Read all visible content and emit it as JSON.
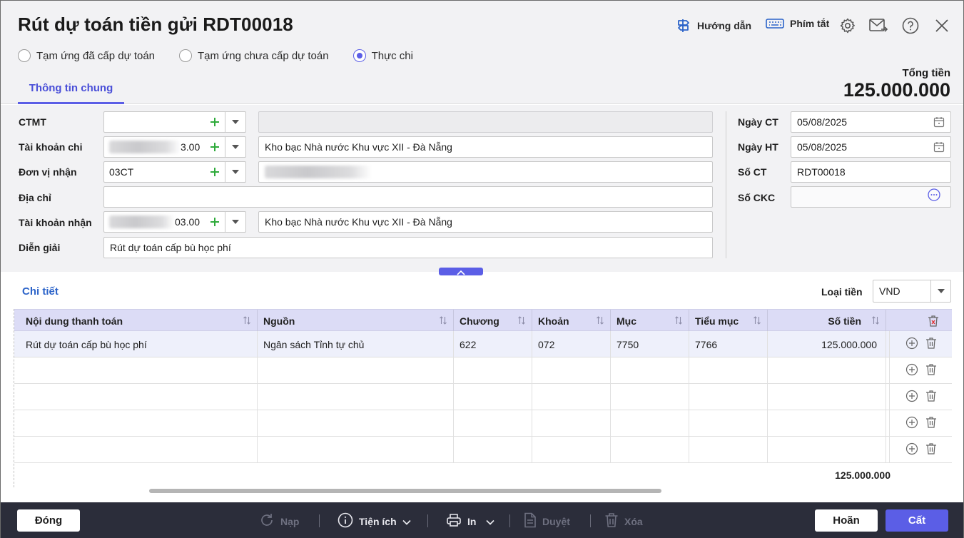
{
  "window": {
    "title": "Rút dự toán tiền gửi RDT00018",
    "tools": {
      "guide": "Hướng dẫn",
      "shortcuts": "Phím tắt"
    }
  },
  "mode_options": [
    {
      "label": "Tạm ứng đã cấp dự toán",
      "checked": false
    },
    {
      "label": "Tạm ứng chưa cấp dự toán",
      "checked": false
    },
    {
      "label": "Thực chi",
      "checked": true
    }
  ],
  "tabs": [
    {
      "label": "Thông tin chung",
      "active": true
    }
  ],
  "total": {
    "label": "Tổng tiền",
    "value": "125.000.000"
  },
  "form": {
    "ctmt": {
      "label": "CTMT",
      "value": "",
      "desc": ""
    },
    "tk_chi": {
      "label": "Tài khoản chi",
      "value_suffix": "3.00",
      "desc": "Kho bạc Nhà nước Khu vực XII - Đà Nẵng"
    },
    "don_vi_nhan": {
      "label": "Đơn vị nhận",
      "value": "03CT",
      "desc": ""
    },
    "dia_chi": {
      "label": "Địa chỉ",
      "value": ""
    },
    "tk_nhan": {
      "label": "Tài khoản nhận",
      "value_suffix": "03.00",
      "desc": "Kho bạc Nhà nước Khu vực XII - Đà Nẵng"
    },
    "dien_giai": {
      "label": "Diễn giải",
      "value": "Rút dự toán cấp bù học phí"
    }
  },
  "side_form": {
    "ngay_ct": {
      "label": "Ngày CT",
      "value": "05/08/2025"
    },
    "ngay_ht": {
      "label": "Ngày HT",
      "value": "05/08/2025"
    },
    "so_ct": {
      "label": "Số CT",
      "value": "RDT00018"
    },
    "so_ckc": {
      "label": "Số CKC",
      "value": ""
    }
  },
  "detail": {
    "title": "Chi tiết",
    "currency_label": "Loại tiền",
    "currency_value": "VND",
    "columns": [
      "Nội dung thanh toán",
      "Nguồn",
      "Chương",
      "Khoản",
      "Mục",
      "Tiểu mục",
      "Số tiền"
    ],
    "rows": [
      {
        "noi_dung": "Rút dự toán cấp bù học phí",
        "nguon": "Ngân sách Tỉnh tự chủ",
        "chuong": "622",
        "khoan": "072",
        "muc": "7750",
        "tieu_muc": "7766",
        "so_tien": "125.000.000"
      }
    ],
    "empty_rows": 4,
    "total": "125.000.000"
  },
  "footer": {
    "close": "Đóng",
    "reload": "Nạp",
    "utilities": "Tiện ích",
    "print": "In",
    "approve": "Duyệt",
    "delete": "Xóa",
    "cancel": "Hoãn",
    "save": "Cất"
  },
  "colors": {
    "accent": "#5b5ee6",
    "header_bg": "#f2f2f4",
    "footer_bg": "#2b2d3a",
    "plus_green": "#2eaa3a",
    "link_blue": "#2b63c9"
  }
}
